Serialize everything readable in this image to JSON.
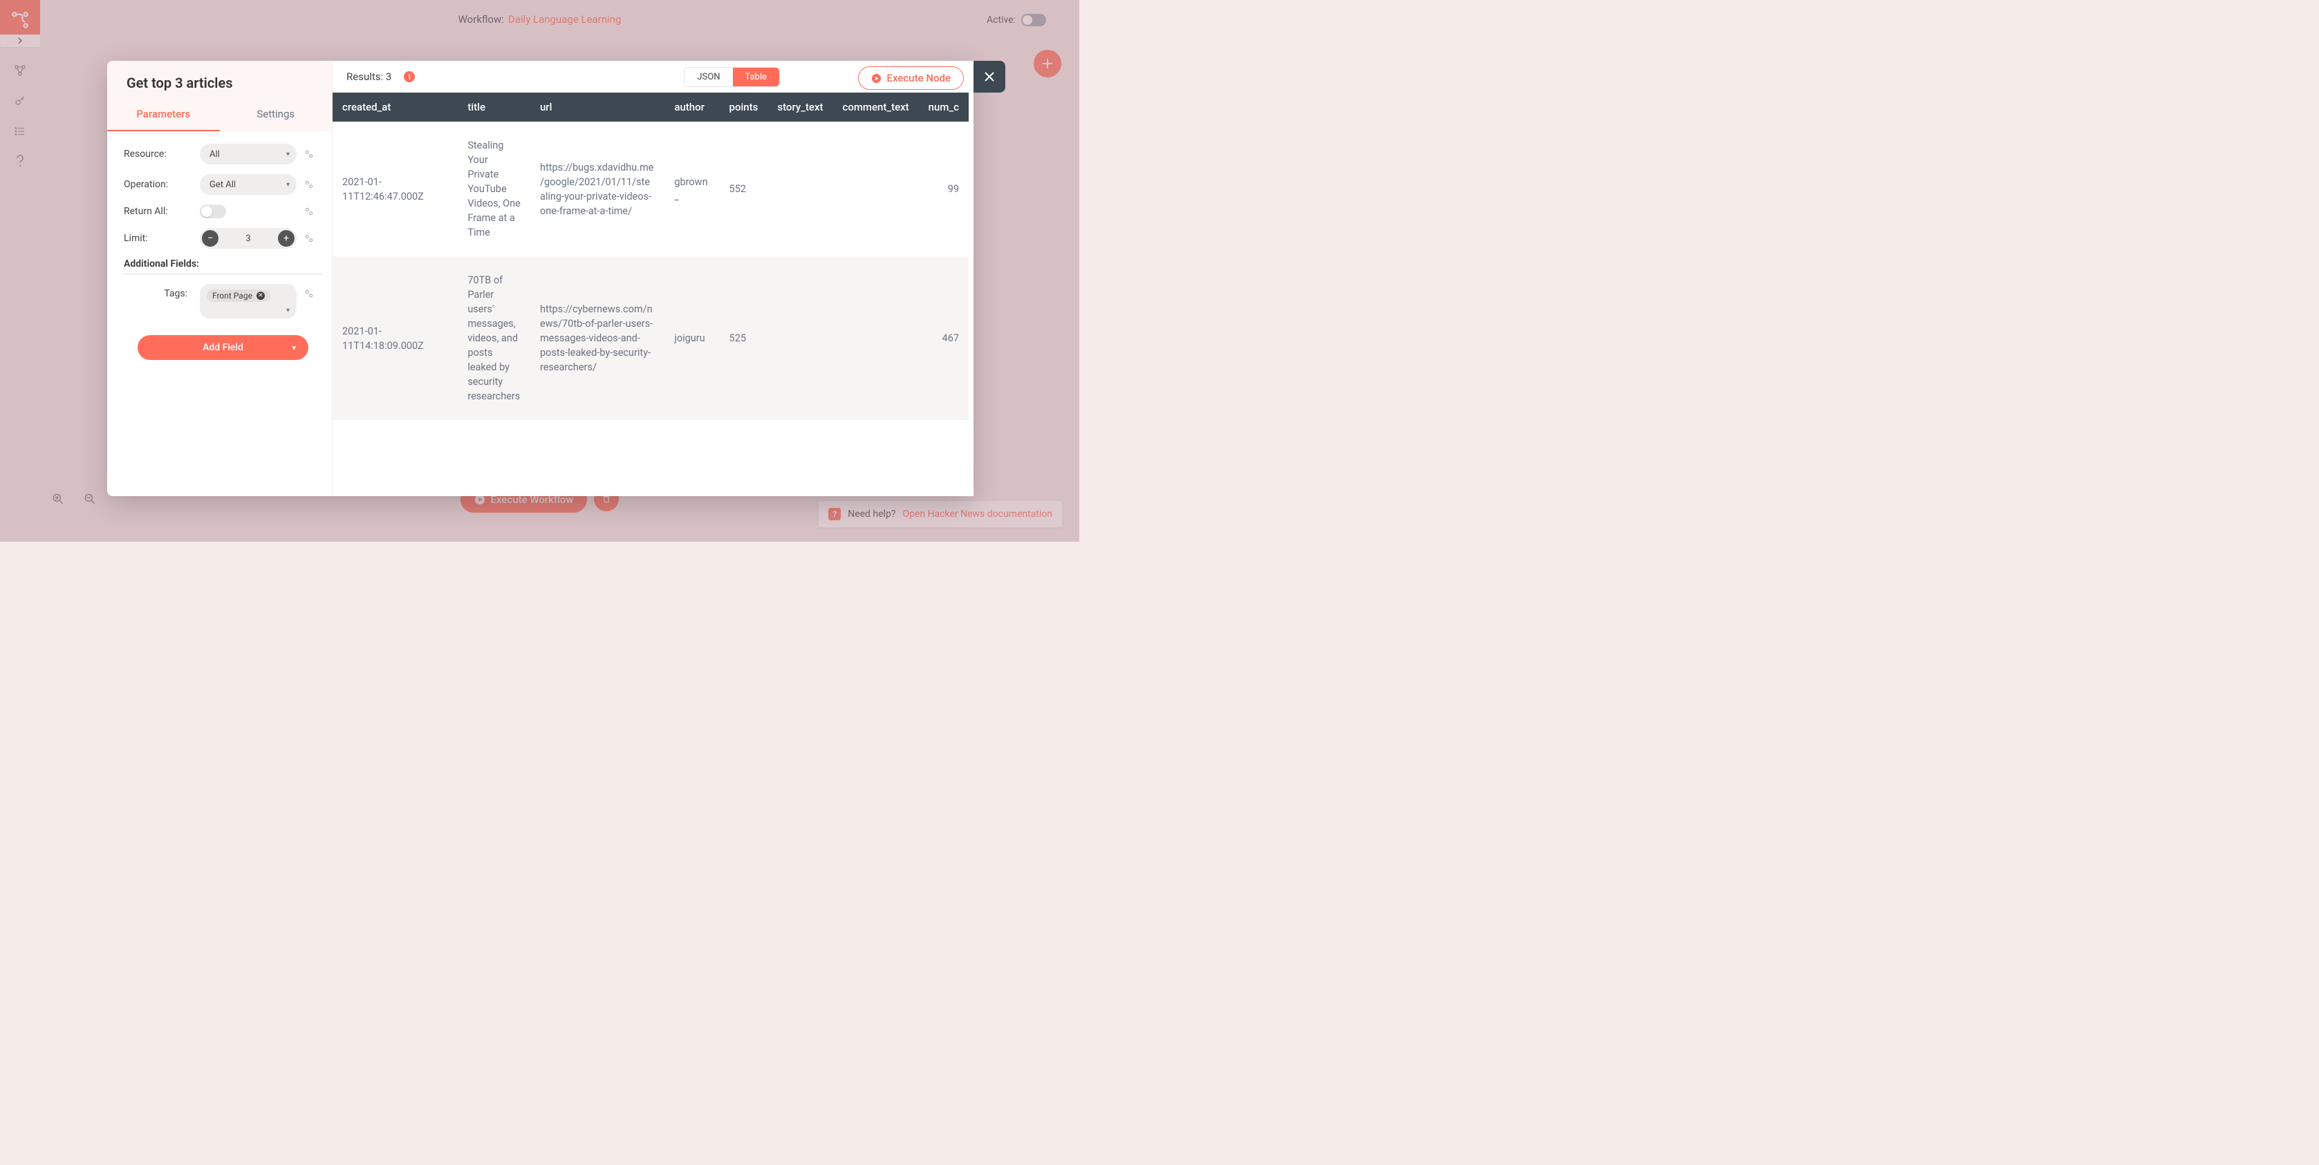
{
  "header": {
    "workflow_prefix": "Workflow:",
    "workflow_name": "Daily Language Learning",
    "active_label": "Active:"
  },
  "help": {
    "text": "Need help?",
    "link_text": "Open Hacker News documentation"
  },
  "exec": {
    "workflow_btn": "Execute Workflow"
  },
  "modal": {
    "title": "Get top 3 articles",
    "tabs": {
      "parameters": "Parameters",
      "settings": "Settings"
    },
    "params": {
      "resource_label": "Resource:",
      "resource_value": "All",
      "operation_label": "Operation:",
      "operation_value": "Get All",
      "return_all_label": "Return All:",
      "limit_label": "Limit:",
      "limit_value": "3",
      "additional_label": "Additional Fields:",
      "tags_label": "Tags:",
      "tags_chip": "Front Page",
      "add_field": "Add Field"
    },
    "results": {
      "label": "Results: 3",
      "view_json": "JSON",
      "view_table": "Table",
      "execute_node": "Execute Node",
      "columns": [
        "created_at",
        "title",
        "url",
        "author",
        "points",
        "story_text",
        "comment_text",
        "num_c"
      ],
      "rows": [
        {
          "created_at": "2021-01-11T12:46:47.000Z",
          "title": "Stealing Your Private YouTube Videos, One Frame at a Time",
          "url": "https://bugs.xdavidhu.me/google/2021/01/11/stealing-your-private-videos-one-frame-at-a-time/",
          "author": "gbrown_",
          "points": "552",
          "story_text": "",
          "comment_text": "",
          "num_c": "99"
        },
        {
          "created_at": "2021-01-11T14:18:09.000Z",
          "title": "70TB of Parler users' messages, videos, and posts leaked by security researchers",
          "url": "https://cybernews.com/news/70tb-of-parler-users-messages-videos-and-posts-leaked-by-security-researchers/",
          "author": "joiguru",
          "points": "525",
          "story_text": "",
          "comment_text": "",
          "num_c": "467"
        }
      ]
    }
  }
}
